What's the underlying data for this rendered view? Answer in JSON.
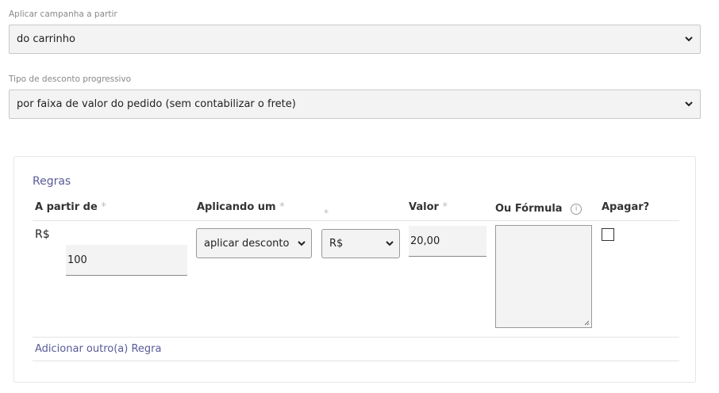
{
  "campaign": {
    "label": "Aplicar campanha a partir",
    "value": "do carrinho"
  },
  "discount_type": {
    "label": "Tipo de desconto progressivo",
    "value": "por faixa de valor do pedido (sem contabilizar o frete)"
  },
  "rules": {
    "title": "Regras",
    "columns": {
      "from": "A partir de",
      "applying": "Aplicando um",
      "value": "Valor",
      "formula": "Ou Fórmula",
      "delete": "Apagar?"
    },
    "required_mark": "*",
    "info_glyph": "i",
    "row": {
      "currency_prefix": "R$",
      "from_value": "100",
      "applying_value": "aplicar desconto",
      "currency_select": "R$",
      "amount": "20,00",
      "formula": "",
      "delete_checked": false
    },
    "add_link": "Adicionar outro(a) Regra"
  }
}
